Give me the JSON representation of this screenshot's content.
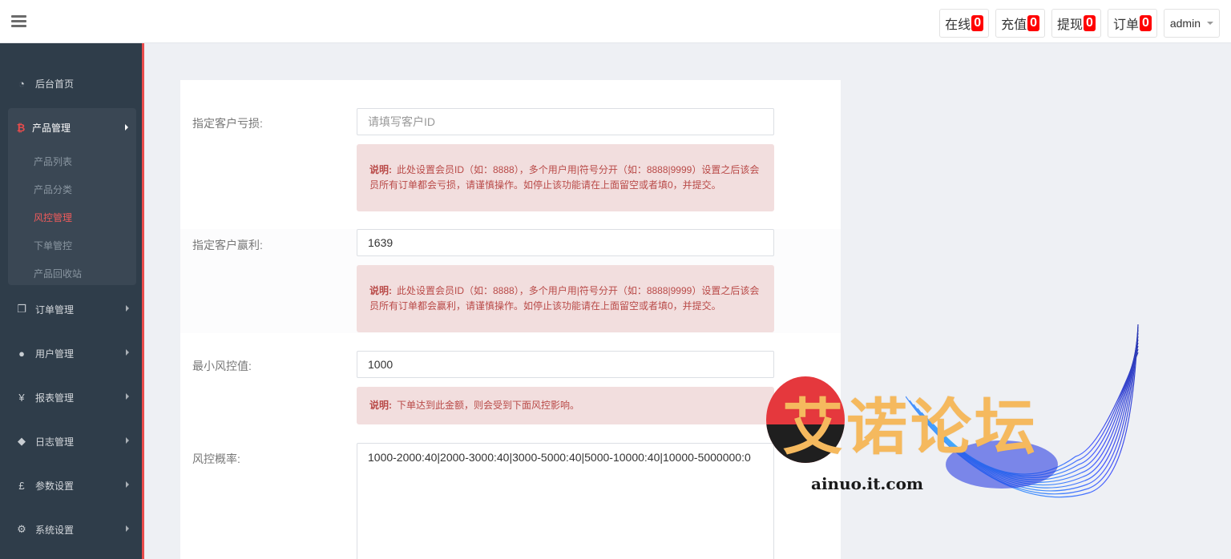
{
  "topbar": {
    "stats": [
      {
        "label": "在线",
        "count": "0"
      },
      {
        "label": "充值",
        "count": "0"
      },
      {
        "label": "提现",
        "count": "0"
      },
      {
        "label": "订单",
        "count": "0"
      }
    ],
    "user": "admin"
  },
  "sidebar": {
    "home": {
      "label": "后台首页",
      "icon": "dashboard-icon"
    },
    "product": {
      "label": "产品管理",
      "icon": "bitcoin-icon",
      "children": [
        "产品列表",
        "产品分类",
        "风控管理",
        "下单管控",
        "产品回收站"
      ],
      "active_child": "风控管理"
    },
    "items": [
      {
        "label": "订单管理",
        "icon": "copy-icon"
      },
      {
        "label": "用户管理",
        "icon": "user-icon"
      },
      {
        "label": "报表管理",
        "icon": "yen-icon"
      },
      {
        "label": "日志管理",
        "icon": "tag-icon"
      },
      {
        "label": "参数设置",
        "icon": "pound-icon"
      },
      {
        "label": "系统设置",
        "icon": "gears-icon"
      }
    ]
  },
  "form": {
    "loss": {
      "label": "指定客户亏损:",
      "placeholder": "请填写客户ID",
      "value": "",
      "note_title": "说明:",
      "note_text": "此处设置会员ID（如：8888），多个用户用|符号分开（如：8888|9999）设置之后该会员所有订单都会亏损，请谨慎操作。如停止该功能请在上面留空或者填0，并提交。"
    },
    "win": {
      "label": "指定客户赢利:",
      "value": "1639",
      "note_title": "说明:",
      "note_text": "此处设置会员ID（如：8888），多个用户用|符号分开（如：8888|9999）设置之后该会员所有订单都会赢利，请谨慎操作。如停止该功能请在上面留空或者填0，并提交。"
    },
    "min_value": {
      "label": "最小风控值:",
      "value": "1000",
      "note_title": "说明:",
      "note_text": "下单达到此金额，则会受到下面风控影响。"
    },
    "rate": {
      "label": "风控概率:",
      "value": "1000-2000:40|2000-3000:40|3000-5000:40|5000-10000:40|10000-5000000:0"
    }
  },
  "watermark": {
    "title": "艾诺论坛",
    "url": "ainuo.it.com"
  }
}
